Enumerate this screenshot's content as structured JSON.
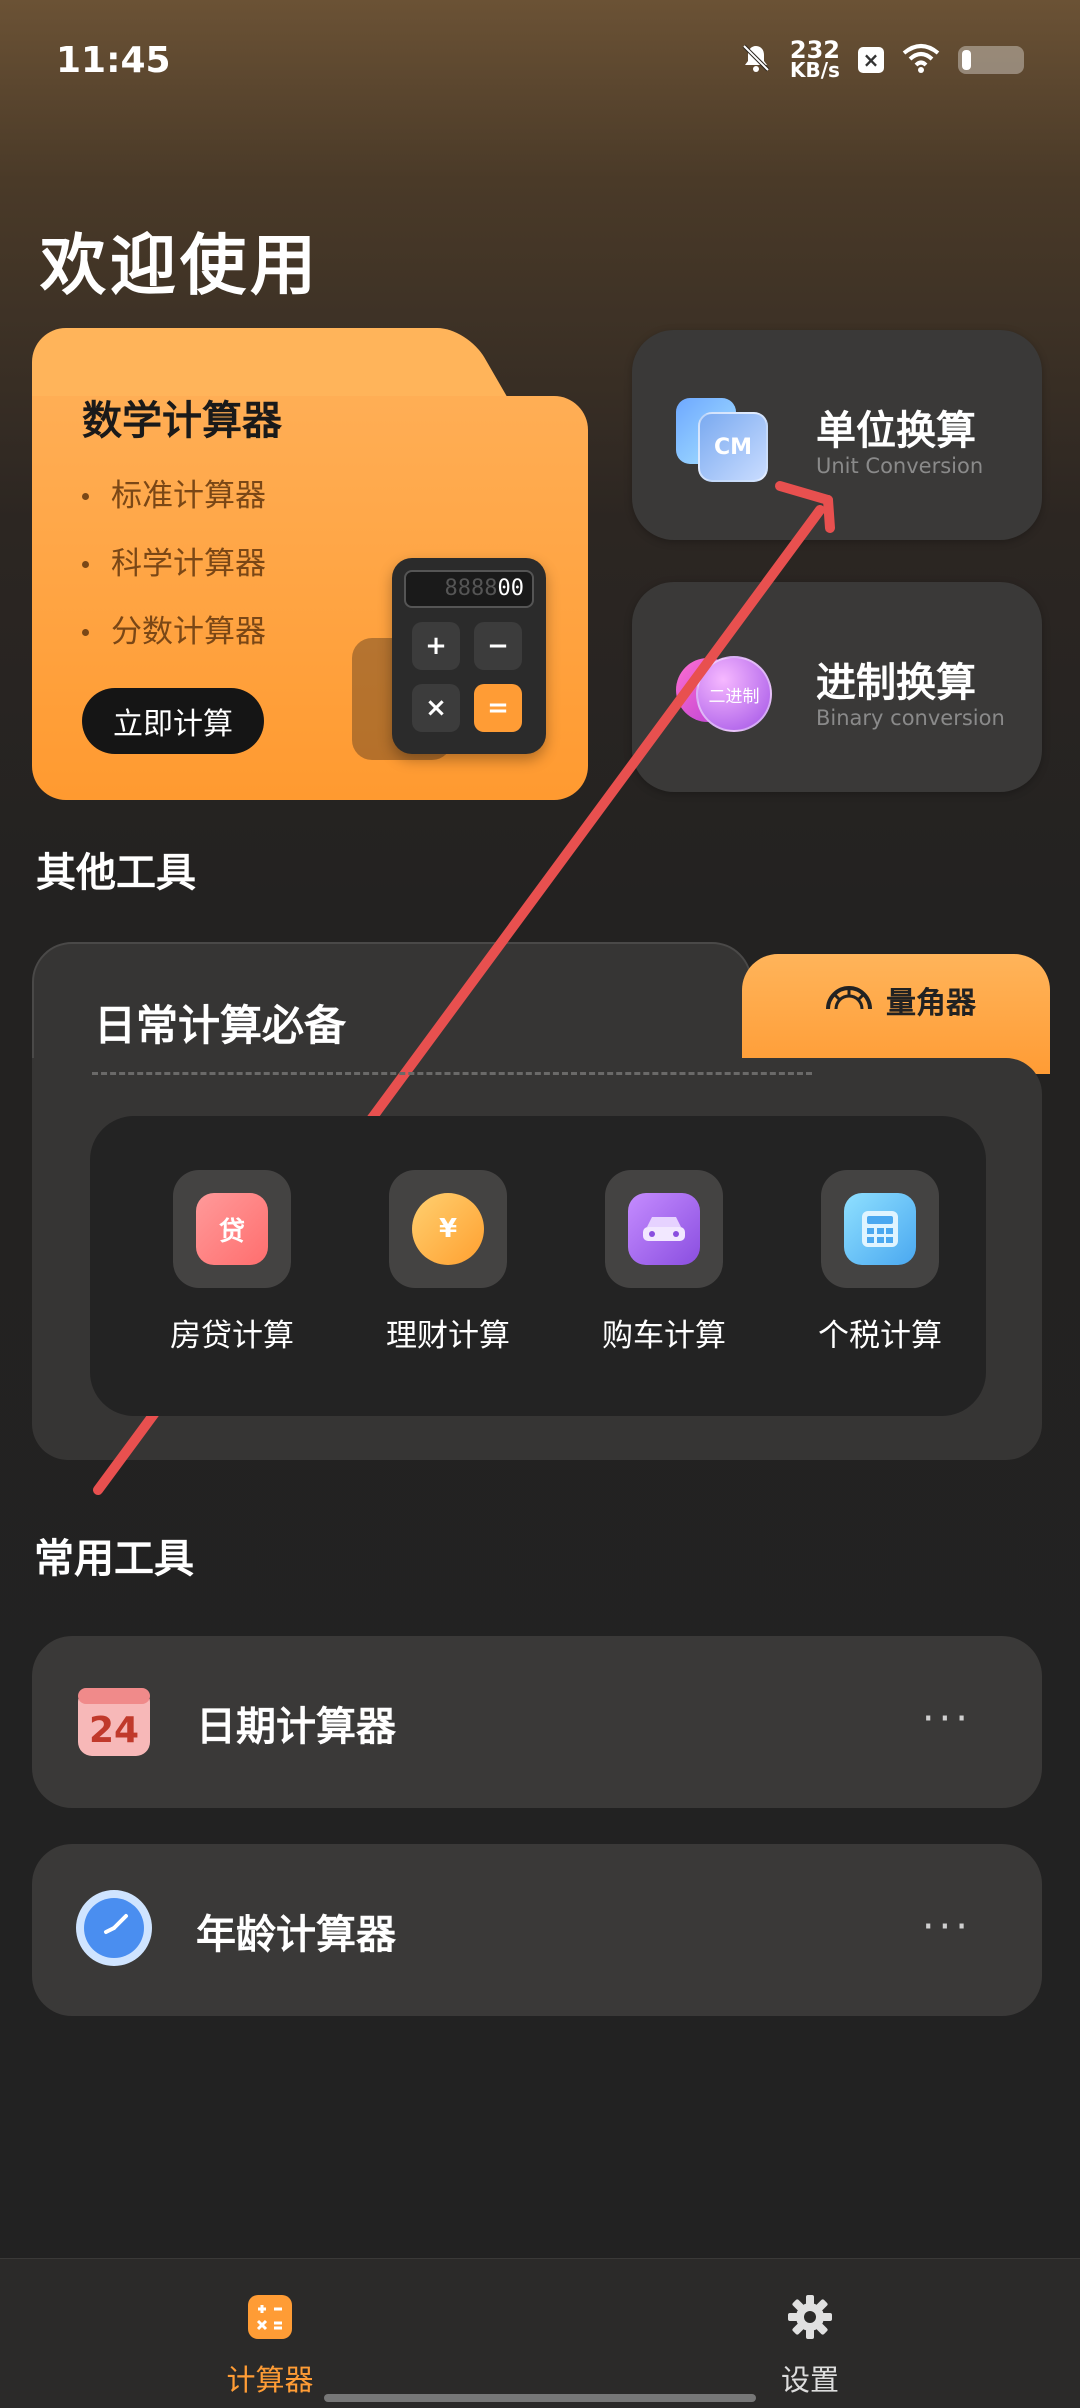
{
  "status_bar": {
    "time": "11:45",
    "net_speed_value": "232",
    "net_speed_unit": "KB/s",
    "x_badge": "×",
    "battery_level": 0.15,
    "icons": [
      "bell-off-icon",
      "wifi-icon",
      "battery-icon"
    ]
  },
  "header": {
    "title": "欢迎使用"
  },
  "math_card": {
    "title": "数学计算器",
    "items": [
      "标准计算器",
      "科学计算器",
      "分数计算器"
    ],
    "button_label": "立即计算",
    "calc_display_dim": "8888",
    "calc_display": "00",
    "keys": [
      "+",
      "−",
      "×",
      "="
    ]
  },
  "unit_conversion": {
    "title": "单位换算",
    "subtitle": "Unit Conversion",
    "icon_text": "CM"
  },
  "binary_conversion": {
    "title": "进制换算",
    "subtitle": "Binary conversion",
    "icon_text": "二进制"
  },
  "other_tools": {
    "section_title": "其他工具",
    "card_title": "日常计算必备",
    "protractor_label": "量角器",
    "items": [
      {
        "label": "房贷计算",
        "icon": "loan-icon",
        "icon_text": "贷",
        "color": "#ff8a8a"
      },
      {
        "label": "理财计算",
        "icon": "coin-icon",
        "icon_text": "¥",
        "color": "#ffb640"
      },
      {
        "label": "购车计算",
        "icon": "car-icon",
        "icon_text": "",
        "color": "#b06cf0"
      },
      {
        "label": "个税计算",
        "icon": "tax-calculator-icon",
        "icon_text": "",
        "color": "#6cc8ff"
      }
    ]
  },
  "common_tools": {
    "section_title": "常用工具",
    "items": [
      {
        "label": "日期计算器",
        "icon": "calendar-icon",
        "icon_text": "24"
      },
      {
        "label": "年龄计算器",
        "icon": "clock-icon",
        "icon_text": ""
      }
    ],
    "more": "···"
  },
  "bottom_nav": {
    "items": [
      {
        "label": "计算器",
        "icon": "calculator-icon",
        "active": true
      },
      {
        "label": "设置",
        "icon": "gear-icon",
        "active": false
      }
    ],
    "active_color": "#ff9c35"
  }
}
